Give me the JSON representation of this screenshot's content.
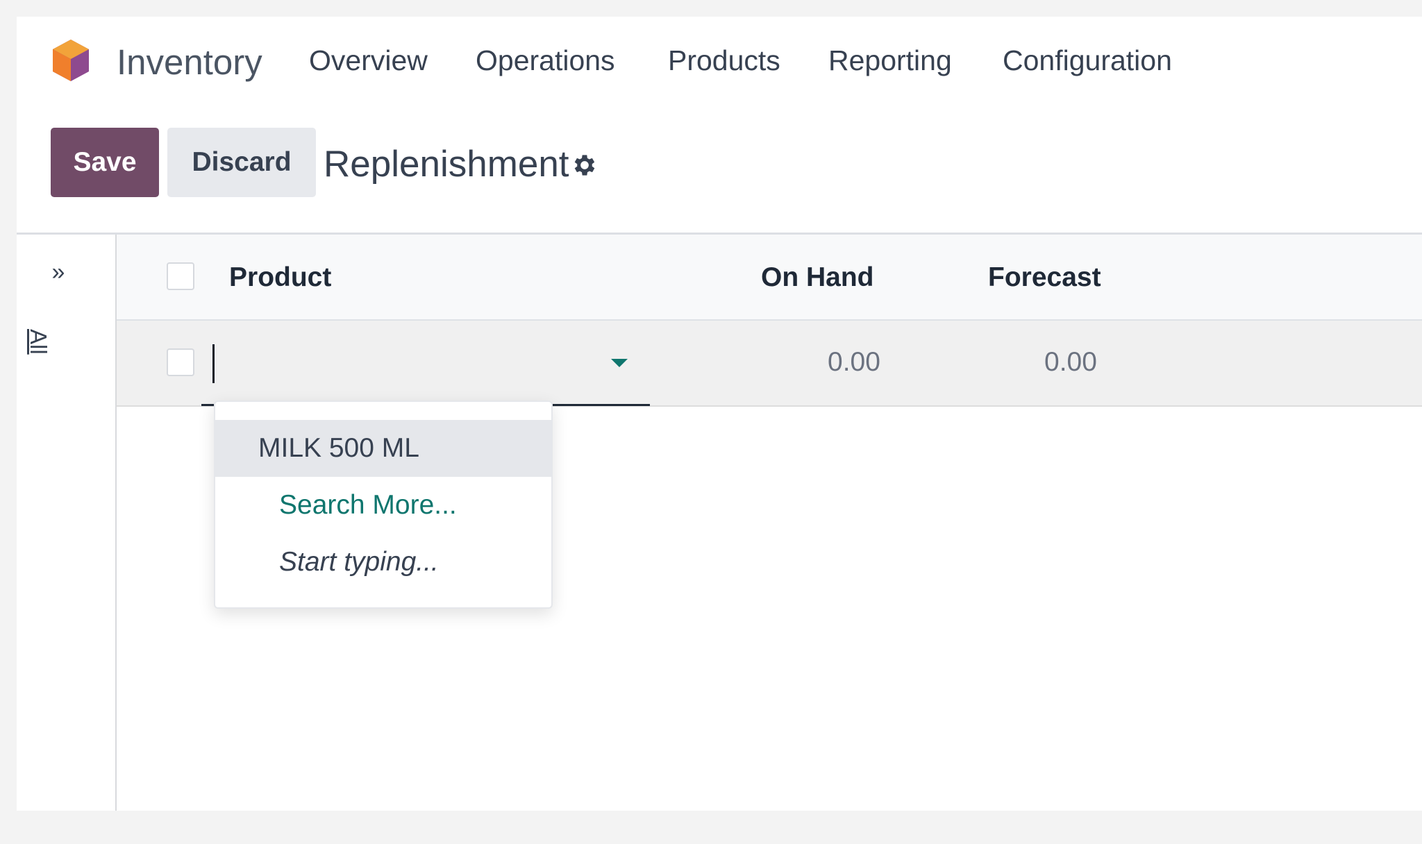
{
  "app": {
    "name": "Inventory"
  },
  "menu": {
    "items": [
      {
        "label": "Overview"
      },
      {
        "label": "Operations"
      },
      {
        "label": "Products"
      },
      {
        "label": "Reporting"
      },
      {
        "label": "Configuration"
      }
    ]
  },
  "control": {
    "save_label": "Save",
    "discard_label": "Discard",
    "title": "Replenishment"
  },
  "side_panel": {
    "filter_label": "All"
  },
  "table": {
    "columns": {
      "product": "Product",
      "on_hand": "On Hand",
      "forecast": "Forecast"
    },
    "edit_row": {
      "on_hand": "0.00",
      "forecast": "0.00"
    }
  },
  "autocomplete": {
    "items": [
      {
        "label": "MILK 500 ML"
      },
      {
        "label": "Search More..."
      },
      {
        "label": "Start typing..."
      }
    ]
  },
  "colors": {
    "brand": "#714b67",
    "accent": "#0f766e"
  }
}
